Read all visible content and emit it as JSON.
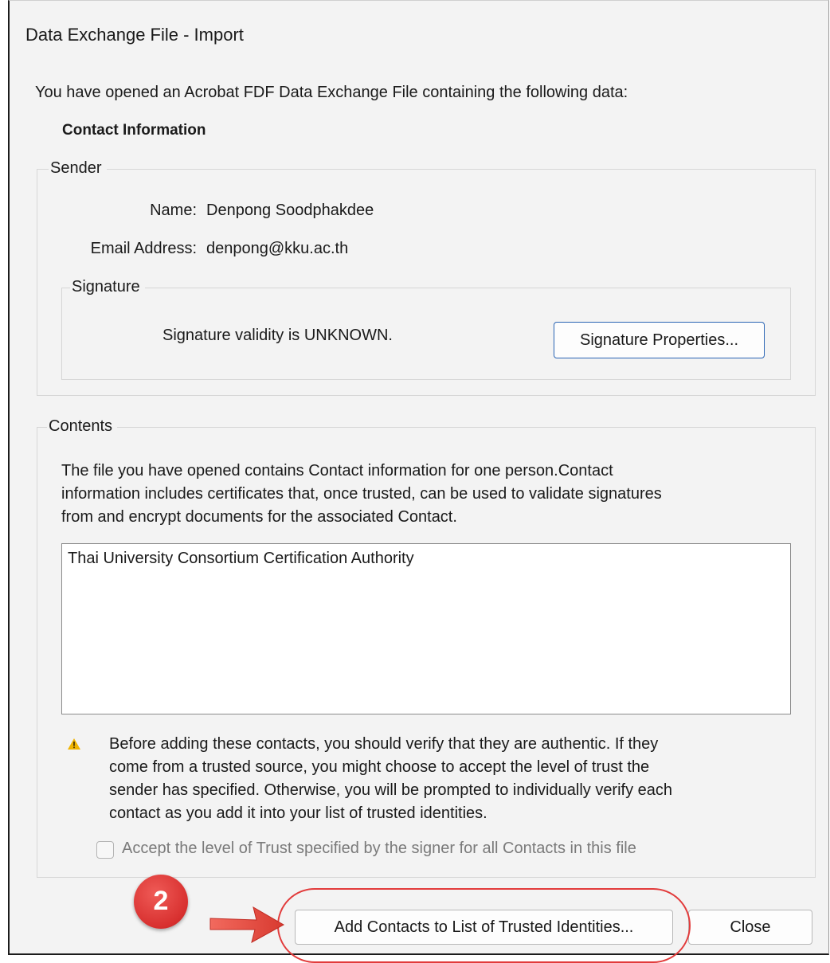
{
  "window": {
    "title": "Data Exchange File - Import"
  },
  "intro_text": "You have opened an Acrobat FDF Data Exchange File containing the following data:",
  "section_heading": "Contact Information",
  "sender": {
    "legend": "Sender",
    "name_label": "Name:",
    "name_value": "Denpong Soodphakdee",
    "email_label": "Email Address:",
    "email_value": "denpong@kku.ac.th",
    "signature": {
      "legend": "Signature",
      "status": "Signature validity is UNKNOWN.",
      "properties_button": "Signature Properties..."
    }
  },
  "contents": {
    "legend": "Contents",
    "description_lines": [
      "The file you have opened contains Contact information for one person.Contact",
      "information includes certificates that, once trusted, can be used to validate signatures",
      "from and encrypt documents for the associated Contact."
    ],
    "list_items": [
      "Thai University Consortium Certification Authority"
    ],
    "warning_lines": [
      "Before adding these contacts, you should verify that they are authentic. If they",
      "come from a trusted source, you might choose to accept the level of trust the",
      "sender has specified. Otherwise, you will be prompted to individually verify each",
      "contact as you add it into your list of trusted identities."
    ],
    "accept_trust_checkbox": {
      "label": "Accept the level of Trust specified by the signer for all Contacts in this file",
      "checked": false,
      "enabled": false
    }
  },
  "buttons": {
    "add_contacts": "Add Contacts to List of Trusted Identities...",
    "close": "Close"
  },
  "annotation": {
    "step_number": "2",
    "color": "#e23b3b"
  },
  "icons": {
    "warning": "warning-icon",
    "arrow": "arrow-right-icon"
  }
}
